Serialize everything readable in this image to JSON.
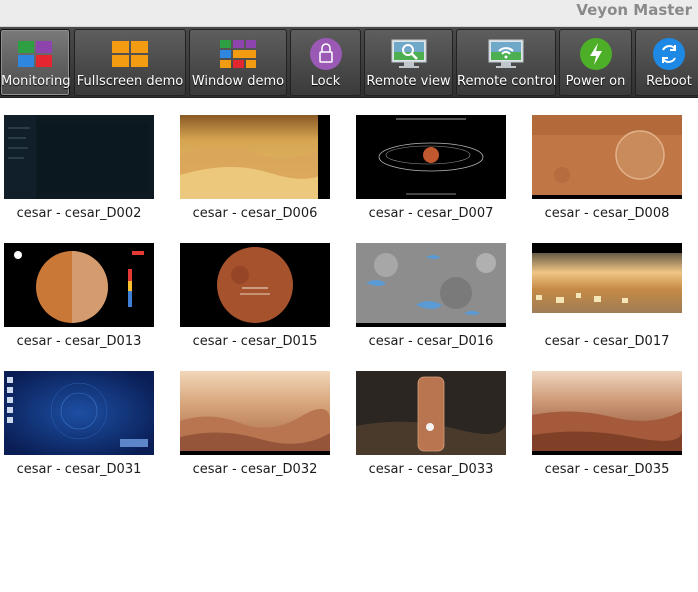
{
  "window": {
    "title": "Veyon Master"
  },
  "toolbar": {
    "buttons": [
      {
        "label": "Monitoring",
        "icon": "monitoring-icon",
        "active": true
      },
      {
        "label": "Fullscreen demo",
        "icon": "fullscreen-demo-icon"
      },
      {
        "label": "Window demo",
        "icon": "window-demo-icon"
      },
      {
        "label": "Lock",
        "icon": "lock-icon"
      },
      {
        "label": "Remote view",
        "icon": "remote-view-icon"
      },
      {
        "label": "Remote control",
        "icon": "remote-control-icon"
      },
      {
        "label": "Power on",
        "icon": "power-on-icon"
      },
      {
        "label": "Reboot",
        "icon": "reboot-icon"
      }
    ]
  },
  "computers": [
    {
      "name": "cesar - cesar_D002",
      "screen": "dark-desktop"
    },
    {
      "name": "cesar - cesar_D006",
      "screen": "desert-dunes"
    },
    {
      "name": "cesar - cesar_D007",
      "screen": "orbit-diagram"
    },
    {
      "name": "cesar - cesar_D008",
      "screen": "mars-crater"
    },
    {
      "name": "cesar - cesar_D013",
      "screen": "mars-globe-chart"
    },
    {
      "name": "cesar - cesar_D015",
      "screen": "mars-globe"
    },
    {
      "name": "cesar - cesar_D016",
      "screen": "grey-terrain"
    },
    {
      "name": "cesar - cesar_D017",
      "screen": "sunset-horizon"
    },
    {
      "name": "cesar - cesar_D031",
      "screen": "blue-desktop"
    },
    {
      "name": "cesar - cesar_D032",
      "screen": "mars-canyon"
    },
    {
      "name": "cesar - cesar_D033",
      "screen": "mars-column"
    },
    {
      "name": "cesar - cesar_D035",
      "screen": "mars-valley"
    }
  ]
}
